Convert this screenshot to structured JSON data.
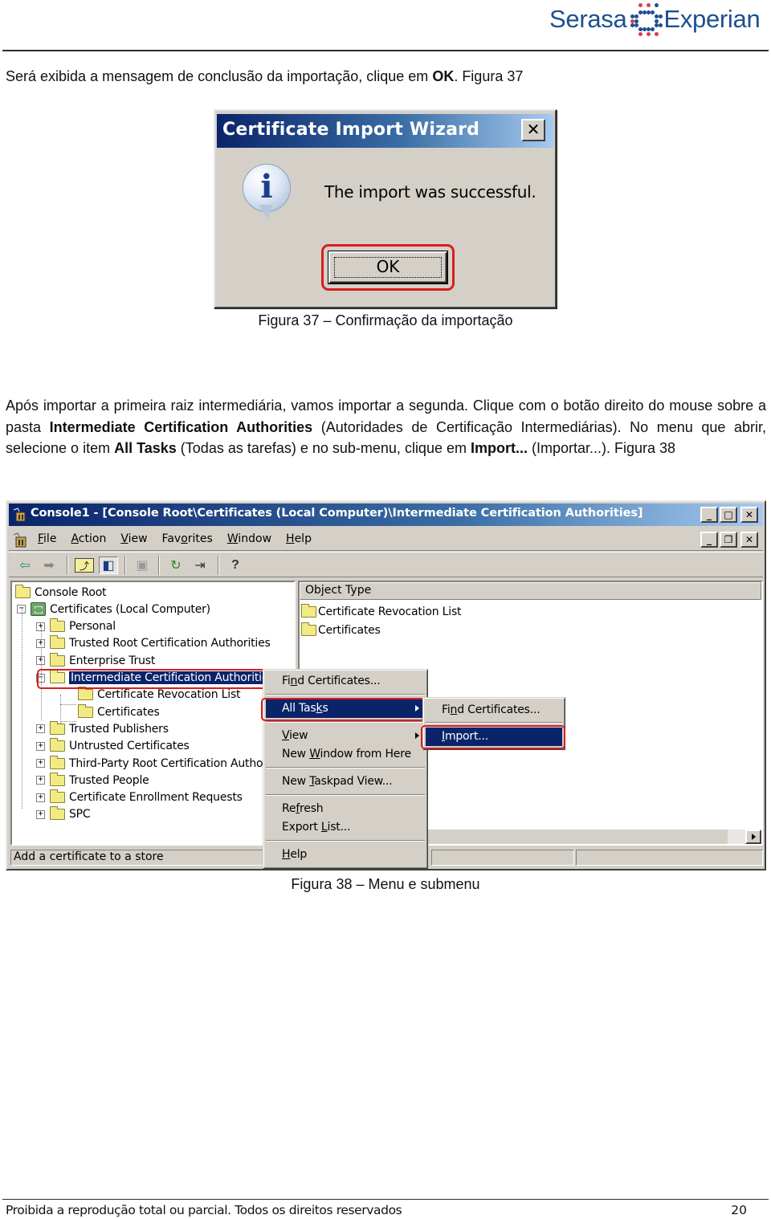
{
  "header": {
    "logo_left": "Serasa",
    "logo_right": "Experian",
    "brand_colors": {
      "blue": "#1d4f91",
      "red": "#d8414a"
    }
  },
  "intro": {
    "before_bold": "Será exibida a mensagem de conclusão da importação, clique em ",
    "bold": "OK",
    "after_bold": ". Figura 37"
  },
  "figure37": {
    "dialog_title": "Certificate Import Wizard",
    "close_glyph": "✕",
    "icon": "information-icon",
    "message": "The import was successful.",
    "ok_label": "OK",
    "highlight_color": "#d81e1e",
    "caption": "Figura 37 – Confirmação da importação"
  },
  "paragraph2": {
    "t1": "Após importar a primeira raiz intermediária, vamos importar a segunda. Clique com o botão direito do mouse sobre a pasta ",
    "b1": "Intermediate Certification Authorities",
    "t2": " (Autoridades de Certificação Intermediárias). No menu que abrir, selecione o item ",
    "b2": "All Tasks",
    "t3": " (Todas as tarefas) e no sub-menu, clique em ",
    "b3": "Import...",
    "t4": " (Importar...). Figura 38"
  },
  "figure38": {
    "window_title": "Console1 - [Console Root\\Certificates (Local Computer)\\Intermediate Certification Authorities]",
    "caption_buttons": [
      "_",
      "□",
      "✕"
    ],
    "child_buttons": [
      "_",
      "❐",
      "✕"
    ],
    "menu": [
      {
        "label": "File",
        "access": "F"
      },
      {
        "label": "Action",
        "access": "A"
      },
      {
        "label": "View",
        "access": "V"
      },
      {
        "label": "Favorites",
        "access": "o"
      },
      {
        "label": "Window",
        "access": "W"
      },
      {
        "label": "Help",
        "access": "H"
      }
    ],
    "toolbar": [
      {
        "icon": "back-arrow-icon",
        "glyph": "⇦"
      },
      {
        "icon": "forward-arrow-icon",
        "glyph": "➡"
      },
      {
        "icon": "up-one-level-icon",
        "glyph": "⤴"
      },
      {
        "icon": "show-hide-tree-icon",
        "glyph": "◧"
      },
      {
        "icon": "paste-icon",
        "glyph": "▣"
      },
      {
        "icon": "refresh-icon",
        "glyph": "↻"
      },
      {
        "icon": "export-list-icon",
        "glyph": "⇥"
      },
      {
        "icon": "help-icon",
        "glyph": "?"
      }
    ],
    "tree": [
      {
        "label": "Console Root",
        "level": 0,
        "expander": "",
        "icon": "folder"
      },
      {
        "label": "Certificates (Local Computer)",
        "level": 1,
        "expander": "−",
        "icon": "certificates"
      },
      {
        "label": "Personal",
        "level": 2,
        "expander": "+",
        "icon": "folder"
      },
      {
        "label": "Trusted Root Certification Authorities",
        "level": 2,
        "expander": "+",
        "icon": "folder"
      },
      {
        "label": "Enterprise Trust",
        "level": 2,
        "expander": "+",
        "icon": "folder"
      },
      {
        "label": "Intermediate Certification Authorities",
        "level": 2,
        "expander": "−",
        "icon": "folder-open",
        "selected": true
      },
      {
        "label": "Certificate Revocation List",
        "level": 3,
        "expander": "",
        "icon": "folder"
      },
      {
        "label": "Certificates",
        "level": 3,
        "expander": "",
        "icon": "folder"
      },
      {
        "label": "Trusted Publishers",
        "level": 2,
        "expander": "+",
        "icon": "folder"
      },
      {
        "label": "Untrusted Certificates",
        "level": 2,
        "expander": "+",
        "icon": "folder"
      },
      {
        "label": "Third-Party Root Certification Authorities",
        "level": 2,
        "expander": "+",
        "icon": "folder"
      },
      {
        "label": "Trusted People",
        "level": 2,
        "expander": "+",
        "icon": "folder"
      },
      {
        "label": "Certificate Enrollment Requests",
        "level": 2,
        "expander": "+",
        "icon": "folder"
      },
      {
        "label": "SPC",
        "level": 2,
        "expander": "+",
        "icon": "folder"
      }
    ],
    "list": {
      "column_header": "Object Type",
      "rows": [
        "Certificate Revocation List",
        "Certificates"
      ]
    },
    "status_text": "Add a certificate to a store",
    "context_menu": [
      {
        "label": "Find Certificates...",
        "access": "n"
      },
      {
        "separator": true
      },
      {
        "label": "All Tasks",
        "access": "k",
        "submenu": true,
        "active": true
      },
      {
        "separator": true
      },
      {
        "label": "View",
        "access": "V",
        "submenu": true
      },
      {
        "label": "New Window from Here",
        "access": "W"
      },
      {
        "separator": true
      },
      {
        "label": "New Taskpad View...",
        "access": "T"
      },
      {
        "separator": true
      },
      {
        "label": "Refresh",
        "access": "f"
      },
      {
        "label": "Export List...",
        "access": "L"
      },
      {
        "separator": true
      },
      {
        "label": "Help",
        "access": "H"
      }
    ],
    "submenu": [
      {
        "label": "Find Certificates...",
        "access": "n"
      },
      {
        "label": "Import...",
        "access": "I",
        "active": true
      }
    ],
    "caption": "Figura 38 – Menu e submenu"
  },
  "footer": {
    "text": "Proibida a reprodução total ou parcial. Todos os direitos reservados",
    "page_number": "20"
  }
}
